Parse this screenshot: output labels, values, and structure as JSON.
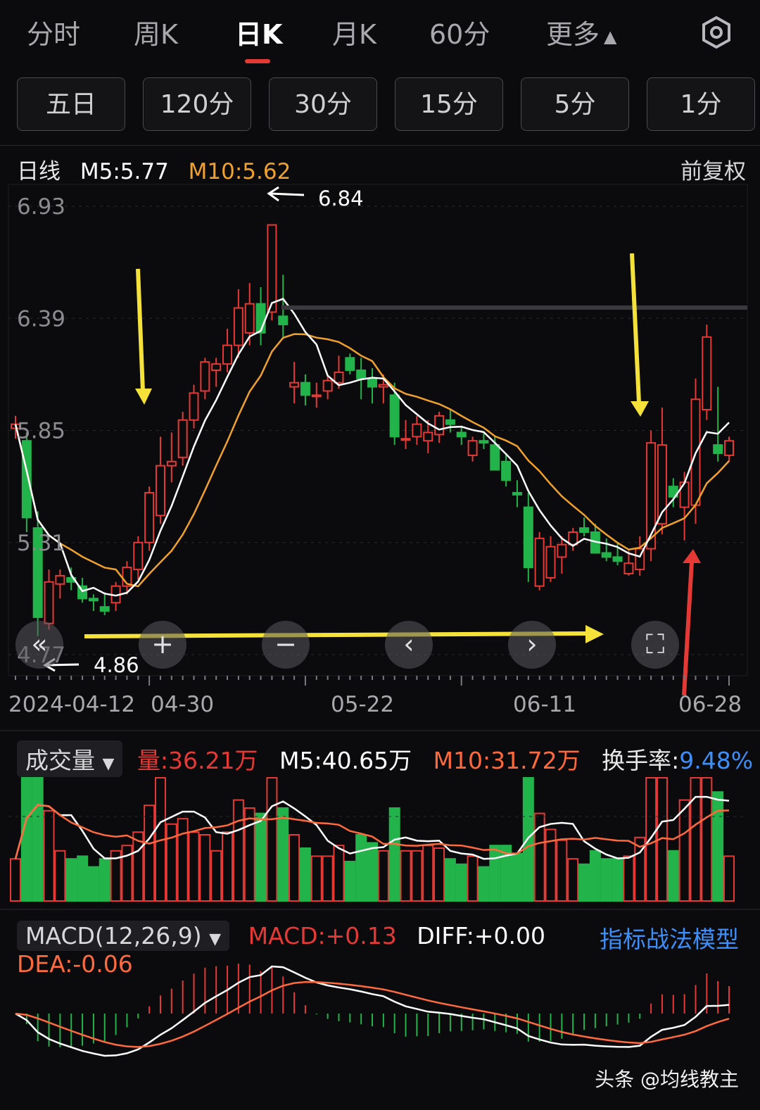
{
  "tabs": [
    {
      "label": "分时",
      "active": false
    },
    {
      "label": "周K",
      "active": false
    },
    {
      "label": "日K",
      "active": true
    },
    {
      "label": "月K",
      "active": false
    },
    {
      "label": "60分",
      "active": false
    },
    {
      "label": "更多",
      "active": false
    }
  ],
  "periods": [
    "五日",
    "120分",
    "30分",
    "15分",
    "5分",
    "1分"
  ],
  "legend": {
    "title": "日线",
    "ma5": "M5:5.77",
    "ma10": "M10:5.62",
    "adjust": "前复权"
  },
  "price_axis": [
    "6.93",
    "6.39",
    "5.85",
    "5.31",
    "4.77"
  ],
  "annotations": {
    "high": "6.84",
    "low": "4.86"
  },
  "date_axis": [
    "2024-04-12",
    "04-30",
    "05-22",
    "06-11",
    "06-28"
  ],
  "volume_bar": {
    "selector": "成交量",
    "vol": "量:36.21万",
    "m5": "M5:40.65万",
    "m10": "M10:31.72万",
    "turnover_label": "换手率:",
    "turnover_value": "9.48%"
  },
  "macd_bar": {
    "selector": "MACD(12,26,9)",
    "macd": "MACD:+0.13",
    "diff": "DIFF:+0.00",
    "dea": "DEA:-0.06",
    "link": "指标战法模型"
  },
  "watermark": "头条 @均线教主",
  "colors": {
    "up": "#e53935",
    "down": "#22b34a",
    "ma5": "#ffffff",
    "ma10": "#f0a12b",
    "accent_arrow": "#f4e23a"
  },
  "chart_data": {
    "type": "candlestick",
    "ylim": [
      4.77,
      6.93
    ],
    "candles": [
      [
        5.86,
        5.92,
        5.81,
        5.88
      ],
      [
        5.8,
        5.84,
        5.36,
        5.43
      ],
      [
        5.38,
        5.46,
        4.86,
        4.95
      ],
      [
        4.92,
        5.18,
        4.89,
        5.12
      ],
      [
        5.11,
        5.18,
        5.04,
        5.15
      ],
      [
        5.14,
        5.19,
        5.08,
        5.12
      ],
      [
        5.1,
        5.14,
        5.02,
        5.04
      ],
      [
        5.04,
        5.06,
        4.98,
        5.03
      ],
      [
        5.0,
        5.07,
        4.96,
        4.98
      ],
      [
        5.02,
        5.12,
        4.98,
        5.1
      ],
      [
        5.1,
        5.22,
        5.06,
        5.19
      ],
      [
        5.18,
        5.34,
        5.13,
        5.31
      ],
      [
        5.31,
        5.58,
        5.27,
        5.55
      ],
      [
        5.44,
        5.82,
        5.4,
        5.68
      ],
      [
        5.68,
        5.84,
        5.6,
        5.7
      ],
      [
        5.72,
        5.94,
        5.68,
        5.9
      ],
      [
        5.9,
        6.07,
        5.86,
        6.03
      ],
      [
        6.04,
        6.2,
        6.0,
        6.18
      ],
      [
        6.14,
        6.2,
        6.06,
        6.17
      ],
      [
        6.17,
        6.34,
        6.13,
        6.26
      ],
      [
        6.26,
        6.53,
        6.2,
        6.44
      ],
      [
        6.32,
        6.56,
        6.26,
        6.46
      ],
      [
        6.46,
        6.54,
        6.26,
        6.32
      ],
      [
        6.42,
        6.84,
        6.38,
        6.84
      ],
      [
        6.4,
        6.6,
        6.3,
        6.36
      ],
      [
        6.06,
        6.18,
        5.98,
        6.08
      ],
      [
        6.08,
        6.12,
        5.97,
        6.02
      ],
      [
        6.02,
        6.08,
        5.96,
        6.02
      ],
      [
        6.04,
        6.12,
        6.0,
        6.09
      ],
      [
        6.08,
        6.21,
        6.05,
        6.13
      ],
      [
        6.2,
        6.22,
        6.12,
        6.14
      ],
      [
        6.14,
        6.2,
        6.0,
        6.1
      ],
      [
        6.1,
        6.15,
        5.98,
        6.06
      ],
      [
        6.06,
        6.12,
        5.98,
        6.07
      ],
      [
        6.02,
        6.08,
        5.78,
        5.82
      ],
      [
        5.81,
        5.9,
        5.76,
        5.81
      ],
      [
        5.82,
        5.92,
        5.78,
        5.88
      ],
      [
        5.8,
        5.9,
        5.74,
        5.84
      ],
      [
        5.83,
        5.94,
        5.79,
        5.92
      ],
      [
        5.9,
        5.95,
        5.84,
        5.88
      ],
      [
        5.84,
        5.87,
        5.78,
        5.82
      ],
      [
        5.73,
        5.82,
        5.7,
        5.8
      ],
      [
        5.8,
        5.84,
        5.76,
        5.79
      ],
      [
        5.78,
        5.82,
        5.66,
        5.66
      ],
      [
        5.7,
        5.74,
        5.58,
        5.61
      ],
      [
        5.55,
        5.61,
        5.48,
        5.54
      ],
      [
        5.48,
        5.55,
        5.12,
        5.19
      ],
      [
        5.1,
        5.36,
        5.08,
        5.33
      ],
      [
        5.14,
        5.34,
        5.12,
        5.29
      ],
      [
        5.24,
        5.34,
        5.16,
        5.3
      ],
      [
        5.3,
        5.38,
        5.27,
        5.36
      ],
      [
        5.38,
        5.43,
        5.34,
        5.36
      ],
      [
        5.36,
        5.4,
        5.26,
        5.26
      ],
      [
        5.26,
        5.33,
        5.22,
        5.24
      ],
      [
        5.24,
        5.31,
        5.2,
        5.22
      ],
      [
        5.16,
        5.27,
        5.15,
        5.21
      ],
      [
        5.18,
        5.34,
        5.15,
        5.28
      ],
      [
        5.28,
        5.85,
        5.22,
        5.79
      ],
      [
        5.4,
        5.96,
        5.35,
        5.78
      ],
      [
        5.58,
        5.62,
        5.48,
        5.53
      ],
      [
        5.48,
        5.65,
        5.32,
        5.6
      ],
      [
        5.49,
        6.1,
        5.4,
        6.0
      ],
      [
        5.95,
        6.36,
        5.9,
        6.3
      ],
      [
        5.78,
        6.06,
        5.7,
        5.74
      ],
      [
        5.73,
        5.82,
        5.7,
        5.8
      ]
    ]
  }
}
